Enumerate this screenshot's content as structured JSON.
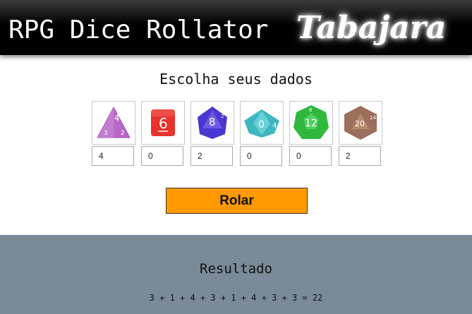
{
  "header": {
    "title": "RPG Dice Rollator",
    "brand": "Tabajara"
  },
  "prompt": "Escolha seus dados",
  "dice": [
    {
      "icon": "d4-die-icon",
      "value": "4",
      "color": "#b560c4",
      "label": "4"
    },
    {
      "icon": "d6-die-icon",
      "value": "0",
      "color": "#e8322b",
      "label": "6"
    },
    {
      "icon": "d8-die-icon",
      "value": "2",
      "color": "#5540d8",
      "label": "8"
    },
    {
      "icon": "d10-die-icon",
      "value": "0",
      "color": "#3fb6c0",
      "label": "0"
    },
    {
      "icon": "d12-die-icon",
      "value": "0",
      "color": "#33c040",
      "label": "12"
    },
    {
      "icon": "d20-die-icon",
      "value": "2",
      "color": "#a07060",
      "label": "20"
    }
  ],
  "roll_button": "Rolar",
  "result": {
    "title": "Resultado",
    "expression": "3 + 1 + 4 + 3 + 1 + 4 + 3 + 3 = 22"
  },
  "colors": {
    "header": "#000000",
    "button": "#ff9900",
    "result_panel": "#7a8a98"
  }
}
